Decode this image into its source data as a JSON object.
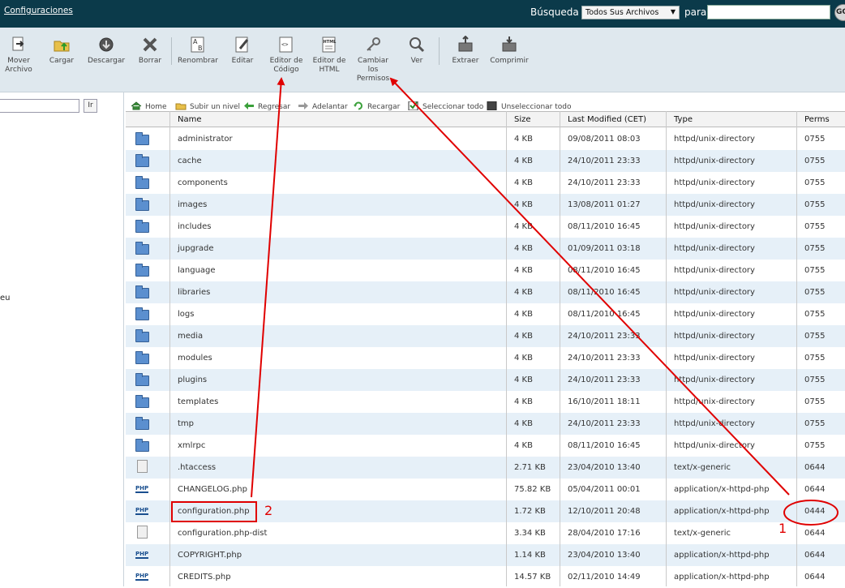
{
  "topbar": {
    "settings_link": "Configuraciones",
    "search_label": "Búsqueda",
    "search_scope": "Todos Sus Archivos",
    "for_label": "para",
    "search_value": "",
    "go_label": "GO"
  },
  "toolbar": {
    "move": [
      "Mover",
      "Archivo"
    ],
    "upload": "Cargar",
    "download": "Descargar",
    "delete": "Borrar",
    "rename": "Renombrar",
    "edit": "Editar",
    "code_editor": [
      "Editor de",
      "Código"
    ],
    "html_editor": [
      "Editor de",
      "HTML"
    ],
    "permissions": [
      "Cambiar",
      "los",
      "Permisos"
    ],
    "view": "Ver",
    "extract": "Extraer",
    "compress": "Comprimir"
  },
  "leftpane": {
    "go_label": "Ir",
    "fragment": "eu"
  },
  "navbar": {
    "home": "Home",
    "up": "Subir un nivel",
    "back": "Regresar",
    "forward": "Adelantar",
    "reload": "Recargar",
    "select_all": "Seleccionar todo",
    "unselect_all": "Unseleccionar todo"
  },
  "table": {
    "headers": {
      "name": "Name",
      "size": "Size",
      "modified": "Last Modified (CET)",
      "type": "Type",
      "perms": "Perms"
    },
    "rows": [
      {
        "icon": "folder",
        "name": "administrator",
        "size": "4 KB",
        "modified": "09/08/2011 08:03",
        "type": "httpd/unix-directory",
        "perms": "0755"
      },
      {
        "icon": "folder",
        "name": "cache",
        "size": "4 KB",
        "modified": "24/10/2011 23:33",
        "type": "httpd/unix-directory",
        "perms": "0755"
      },
      {
        "icon": "folder",
        "name": "components",
        "size": "4 KB",
        "modified": "24/10/2011 23:33",
        "type": "httpd/unix-directory",
        "perms": "0755"
      },
      {
        "icon": "folder",
        "name": "images",
        "size": "4 KB",
        "modified": "13/08/2011 01:27",
        "type": "httpd/unix-directory",
        "perms": "0755"
      },
      {
        "icon": "folder",
        "name": "includes",
        "size": "4 KB",
        "modified": "08/11/2010 16:45",
        "type": "httpd/unix-directory",
        "perms": "0755"
      },
      {
        "icon": "folder",
        "name": "jupgrade",
        "size": "4 KB",
        "modified": "01/09/2011 03:18",
        "type": "httpd/unix-directory",
        "perms": "0755"
      },
      {
        "icon": "folder",
        "name": "language",
        "size": "4 KB",
        "modified": "08/11/2010 16:45",
        "type": "httpd/unix-directory",
        "perms": "0755"
      },
      {
        "icon": "folder",
        "name": "libraries",
        "size": "4 KB",
        "modified": "08/11/2010 16:45",
        "type": "httpd/unix-directory",
        "perms": "0755"
      },
      {
        "icon": "folder",
        "name": "logs",
        "size": "4 KB",
        "modified": "08/11/2010 16:45",
        "type": "httpd/unix-directory",
        "perms": "0755"
      },
      {
        "icon": "folder",
        "name": "media",
        "size": "4 KB",
        "modified": "24/10/2011 23:33",
        "type": "httpd/unix-directory",
        "perms": "0755"
      },
      {
        "icon": "folder",
        "name": "modules",
        "size": "4 KB",
        "modified": "24/10/2011 23:33",
        "type": "httpd/unix-directory",
        "perms": "0755"
      },
      {
        "icon": "folder",
        "name": "plugins",
        "size": "4 KB",
        "modified": "24/10/2011 23:33",
        "type": "httpd/unix-directory",
        "perms": "0755"
      },
      {
        "icon": "folder",
        "name": "templates",
        "size": "4 KB",
        "modified": "16/10/2011 18:11",
        "type": "httpd/unix-directory",
        "perms": "0755"
      },
      {
        "icon": "folder",
        "name": "tmp",
        "size": "4 KB",
        "modified": "24/10/2011 23:33",
        "type": "httpd/unix-directory",
        "perms": "0755"
      },
      {
        "icon": "folder",
        "name": "xmlrpc",
        "size": "4 KB",
        "modified": "08/11/2010 16:45",
        "type": "httpd/unix-directory",
        "perms": "0755"
      },
      {
        "icon": "generic",
        "name": ".htaccess",
        "size": "2.71 KB",
        "modified": "23/04/2010 13:40",
        "type": "text/x-generic",
        "perms": "0644"
      },
      {
        "icon": "php",
        "name": "CHANGELOG.php",
        "size": "75.82 KB",
        "modified": "05/04/2011 00:01",
        "type": "application/x-httpd-php",
        "perms": "0644"
      },
      {
        "icon": "php",
        "name": "configuration.php",
        "size": "1.72 KB",
        "modified": "12/10/2011 20:48",
        "type": "application/x-httpd-php",
        "perms": "0444"
      },
      {
        "icon": "generic",
        "name": "configuration.php-dist",
        "size": "3.34 KB",
        "modified": "28/04/2010 17:16",
        "type": "text/x-generic",
        "perms": "0644"
      },
      {
        "icon": "php",
        "name": "COPYRIGHT.php",
        "size": "1.14 KB",
        "modified": "23/04/2010 13:40",
        "type": "application/x-httpd-php",
        "perms": "0644"
      },
      {
        "icon": "php",
        "name": "CREDITS.php",
        "size": "14.57 KB",
        "modified": "02/11/2010 14:49",
        "type": "application/x-httpd-php",
        "perms": "0644"
      }
    ]
  },
  "annotations": {
    "label_1": "1",
    "label_2": "2",
    "color": "#e00000"
  },
  "colors": {
    "topbar": "#0b3a4a",
    "toolbar": "#dfe8ee",
    "row_alt": "#e6f0f8"
  }
}
